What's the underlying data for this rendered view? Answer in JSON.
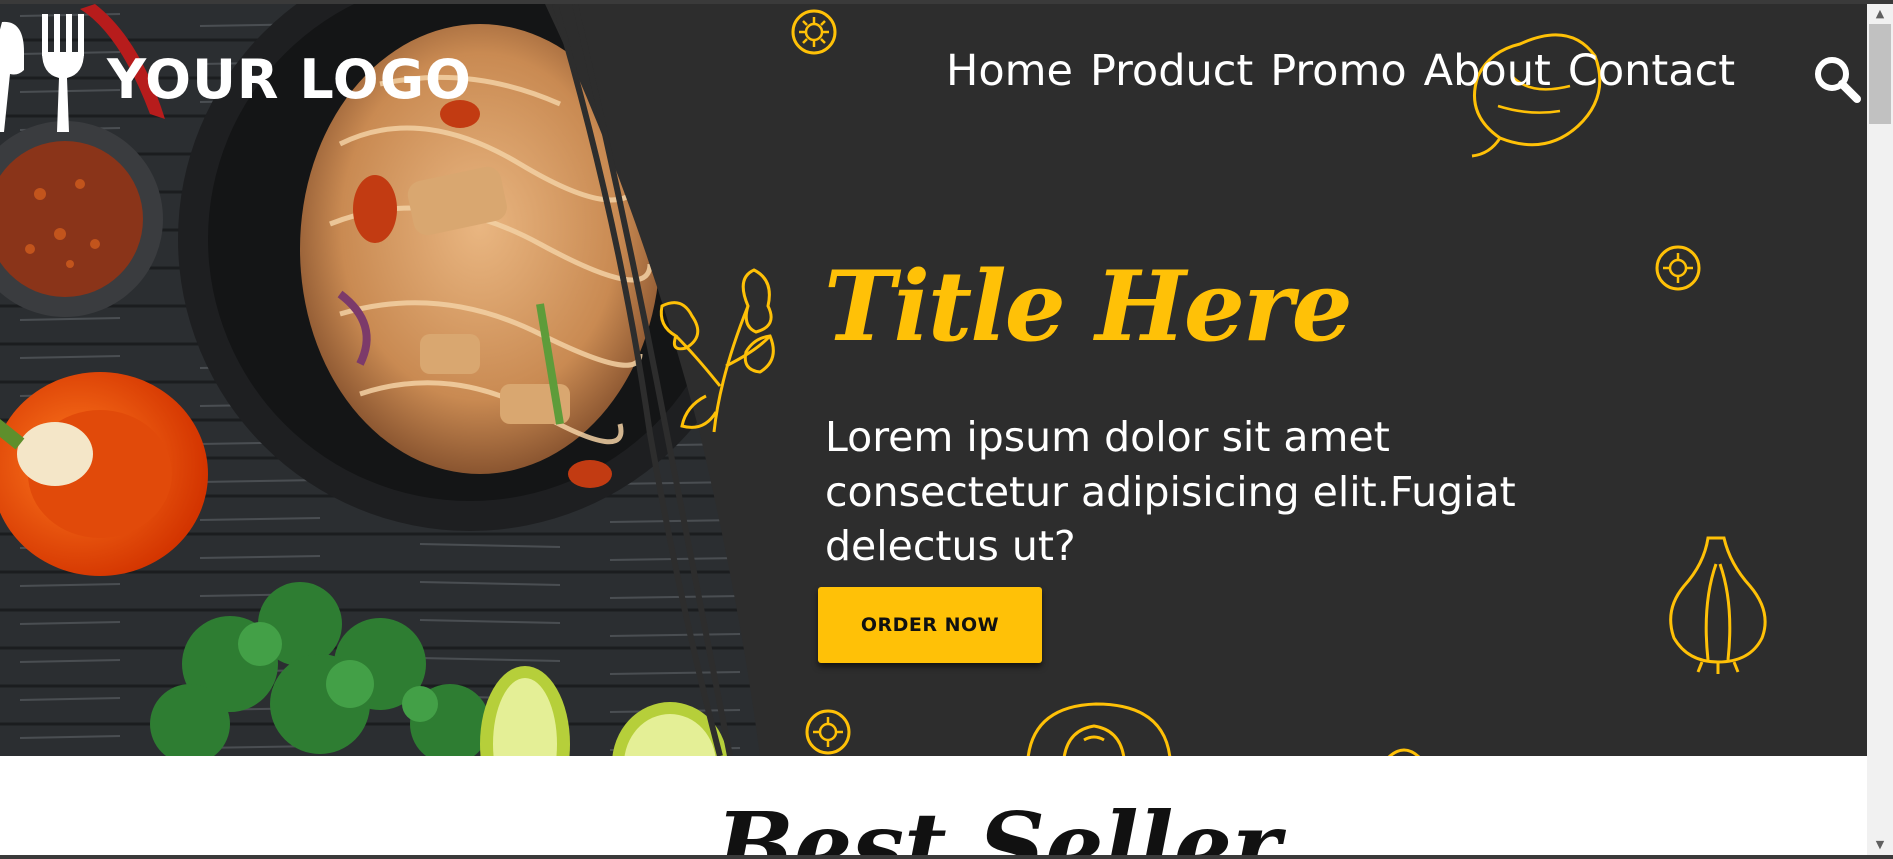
{
  "logo": {
    "text": "YOUR LOGO",
    "icon": "fork-and-knife-icon"
  },
  "nav": {
    "links": [
      "Home",
      "Product",
      "Promo",
      "About",
      "Contact"
    ],
    "search_icon": "search-icon"
  },
  "hero": {
    "title": "Title Here",
    "description": "Lorem ipsum dolor sit amet consectetur adipisicing elit.Fugiat delectus ut?",
    "cta_label": "ORDER NOW"
  },
  "next_section": {
    "title": "Best Seller"
  },
  "colors": {
    "accent": "#ffc107",
    "hero_background": "#2d2d2d",
    "text_light": "#ffffff",
    "text_dark": "#111111"
  },
  "scrollbar": {
    "up_icon": "scroll-up-arrow-icon",
    "down_icon": "scroll-down-arrow-icon"
  }
}
